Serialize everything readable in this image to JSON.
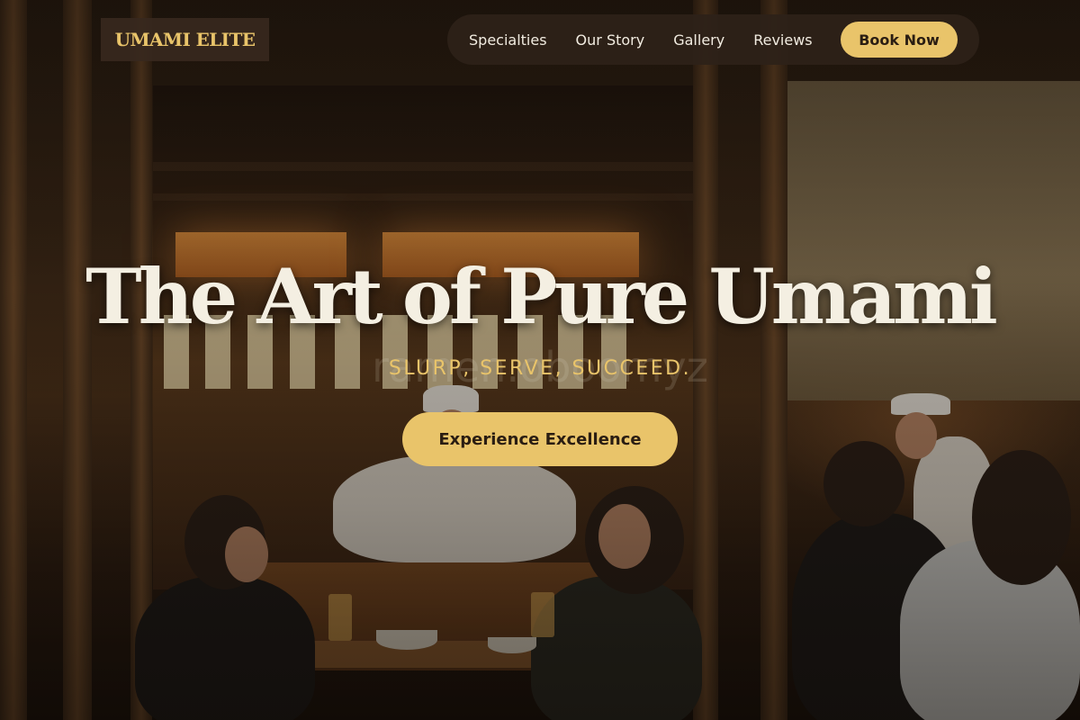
{
  "logo": {
    "text": "UMAMI ELITE"
  },
  "nav": {
    "links": [
      "Specialties",
      "Our Story",
      "Gallery",
      "Reviews"
    ],
    "cta_label": "Book Now"
  },
  "hero": {
    "title": "The Art of Pure Umami",
    "subtitle": "SLURP, SERVE, SUCCEED.",
    "watermark": "ramen.oboomyz",
    "cta_label": "Experience Excellence",
    "background": "restaurant-interior-photo"
  },
  "colors": {
    "accent": "#e9c46a",
    "nav_background": "#2d2119",
    "title_text": "#f4efe2"
  }
}
